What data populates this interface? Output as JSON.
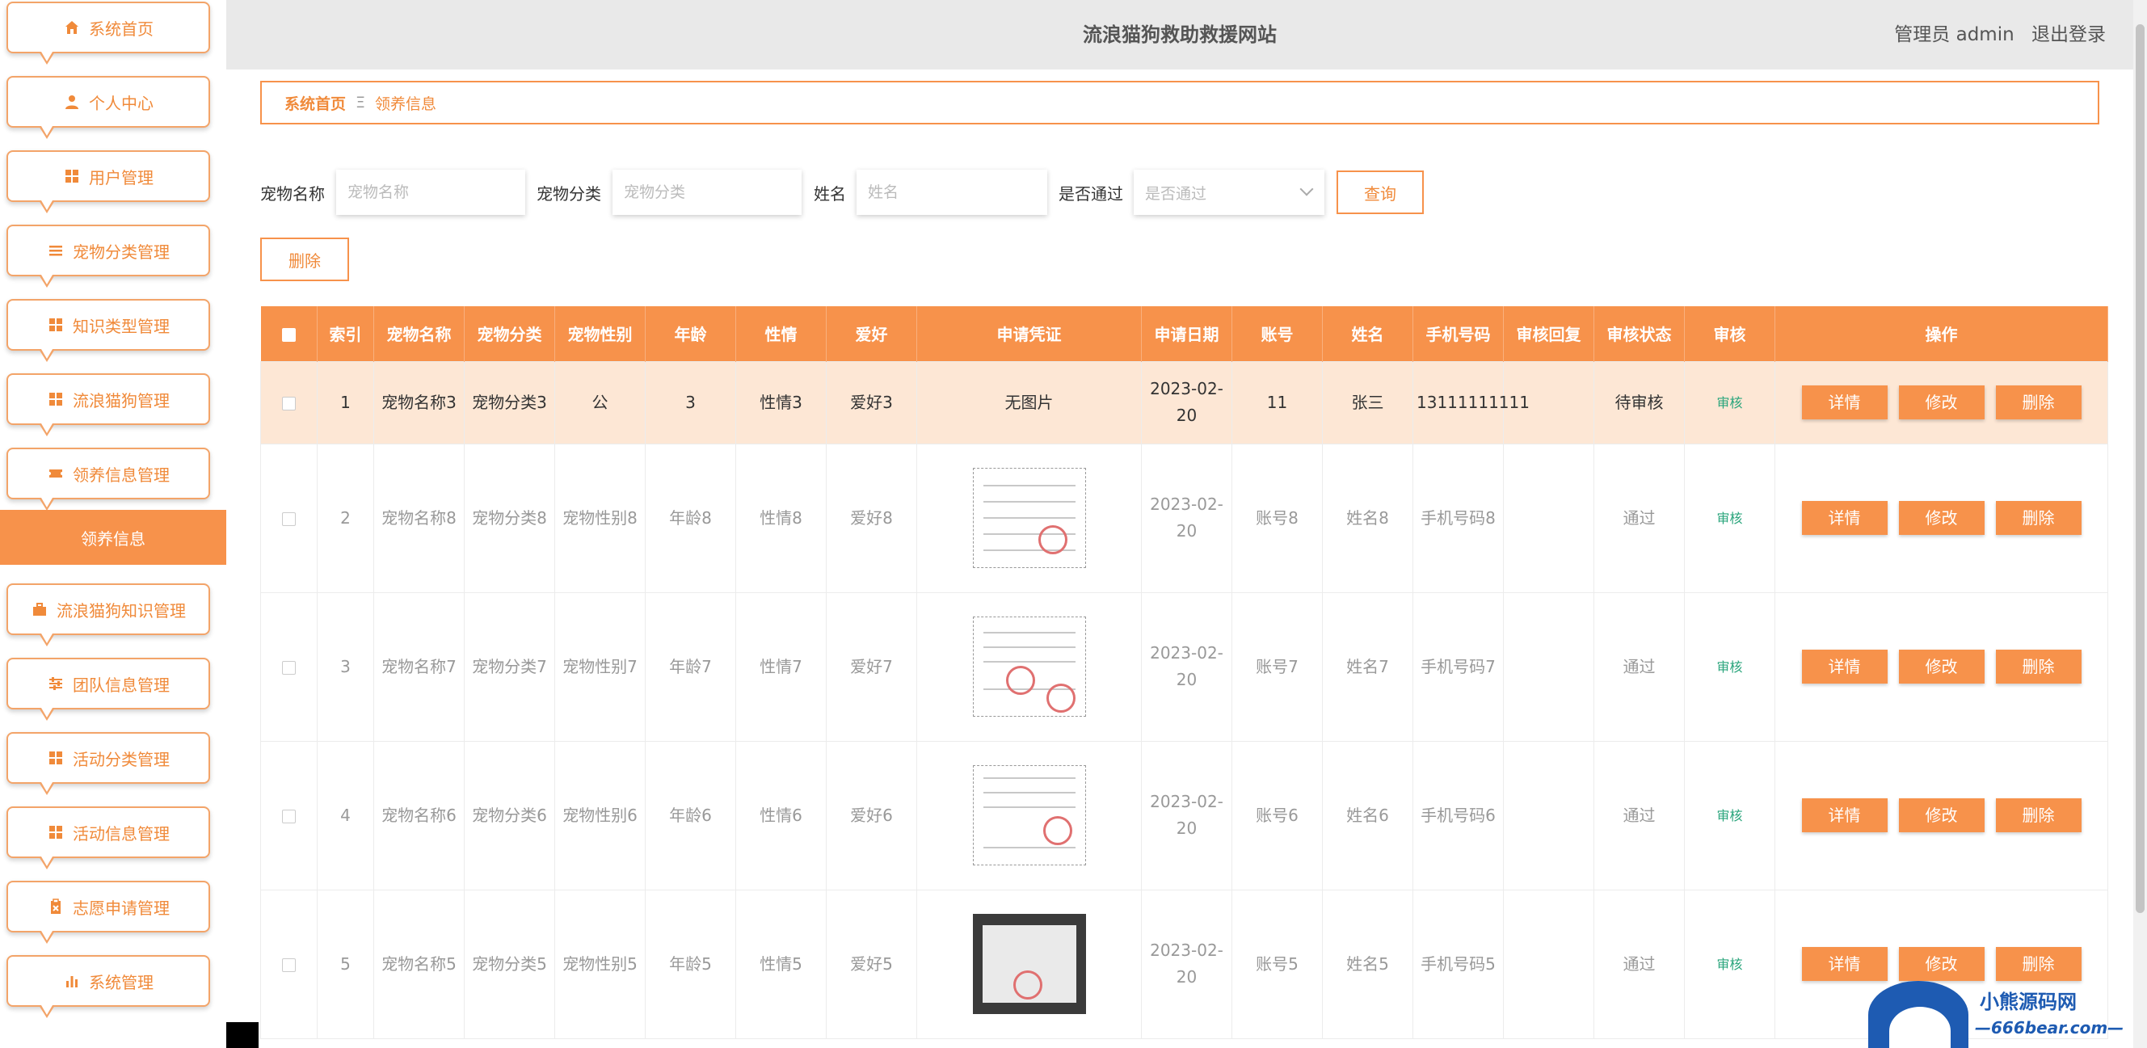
{
  "header": {
    "title": "流浪猫狗救助救援网站",
    "user_label": "管理员 admin",
    "logout_label": "退出登录"
  },
  "sidebar": {
    "items": [
      {
        "label": "系统首页",
        "icon": "home-icon"
      },
      {
        "label": "个人中心",
        "icon": "user-icon"
      },
      {
        "label": "用户管理",
        "icon": "grid-icon"
      },
      {
        "label": "宠物分类管理",
        "icon": "list-icon"
      },
      {
        "label": "知识类型管理",
        "icon": "grid-icon"
      },
      {
        "label": "流浪猫狗管理",
        "icon": "grid-icon"
      },
      {
        "label": "领养信息管理",
        "icon": "ticket-icon"
      },
      {
        "label": "流浪猫狗知识管理",
        "icon": "briefcase-icon"
      },
      {
        "label": "团队信息管理",
        "icon": "sliders-icon"
      },
      {
        "label": "活动分类管理",
        "icon": "grid-icon"
      },
      {
        "label": "活动信息管理",
        "icon": "grid-icon"
      },
      {
        "label": "志愿申请管理",
        "icon": "clipboard-icon"
      },
      {
        "label": "系统管理",
        "icon": "bar-chart-icon"
      }
    ],
    "active_sub": "领养信息"
  },
  "breadcrumb": {
    "home": "系统首页",
    "separator": "Ξ",
    "current": "领养信息"
  },
  "search": {
    "pet_name_label": "宠物名称",
    "pet_name_placeholder": "宠物名称",
    "pet_cat_label": "宠物分类",
    "pet_cat_placeholder": "宠物分类",
    "name_label": "姓名",
    "name_placeholder": "姓名",
    "pass_label": "是否通过",
    "pass_placeholder": "是否通过",
    "query_button": "查询",
    "delete_button": "删除"
  },
  "table": {
    "columns": [
      "索引",
      "宠物名称",
      "宠物分类",
      "宠物性别",
      "年龄",
      "性情",
      "爱好",
      "申请凭证",
      "申请日期",
      "账号",
      "姓名",
      "手机号码",
      "审核回复",
      "审核状态",
      "审核",
      "操作"
    ],
    "rows": [
      {
        "index": "1",
        "pet_name": "宠物名称3",
        "pet_cat": "宠物分类3",
        "gender": "公",
        "age": "3",
        "temper": "性情3",
        "hobby": "爱好3",
        "voucher": "无图片",
        "date": "2023-02-20",
        "account": "11",
        "name": "张三",
        "phone": "13111111111",
        "reply": "",
        "status": "待审核",
        "audit": "审核"
      },
      {
        "index": "2",
        "pet_name": "宠物名称8",
        "pet_cat": "宠物分类8",
        "gender": "宠物性别8",
        "age": "年龄8",
        "temper": "性情8",
        "hobby": "爱好8",
        "voucher": "",
        "date": "2023-02-20",
        "account": "账号8",
        "name": "姓名8",
        "phone": "手机号码8",
        "reply": "",
        "status": "通过",
        "audit": "审核"
      },
      {
        "index": "3",
        "pet_name": "宠物名称7",
        "pet_cat": "宠物分类7",
        "gender": "宠物性别7",
        "age": "年龄7",
        "temper": "性情7",
        "hobby": "爱好7",
        "voucher": "",
        "date": "2023-02-20",
        "account": "账号7",
        "name": "姓名7",
        "phone": "手机号码7",
        "reply": "",
        "status": "通过",
        "audit": "审核"
      },
      {
        "index": "4",
        "pet_name": "宠物名称6",
        "pet_cat": "宠物分类6",
        "gender": "宠物性别6",
        "age": "年龄6",
        "temper": "性情6",
        "hobby": "爱好6",
        "voucher": "",
        "date": "2023-02-20",
        "account": "账号6",
        "name": "姓名6",
        "phone": "手机号码6",
        "reply": "",
        "status": "通过",
        "audit": "审核"
      },
      {
        "index": "5",
        "pet_name": "宠物名称5",
        "pet_cat": "宠物分类5",
        "gender": "宠物性别5",
        "age": "年龄5",
        "temper": "性情5",
        "hobby": "爱好5",
        "voucher": "",
        "date": "2023-02-20",
        "account": "账号5",
        "name": "姓名5",
        "phone": "手机号码5",
        "reply": "",
        "status": "通过",
        "audit": "审核"
      }
    ],
    "actions": {
      "detail": "详情",
      "edit": "修改",
      "delete": "删除"
    }
  },
  "watermark": {
    "line1": "小熊源码网",
    "line2": "—666bear.com—"
  },
  "colors": {
    "accent": "#f7924b",
    "accent_text": "#f08a3a",
    "audit_link": "#2aa57c",
    "highlight_row": "#fde7d5",
    "header_bg": "#e9e9e9"
  }
}
